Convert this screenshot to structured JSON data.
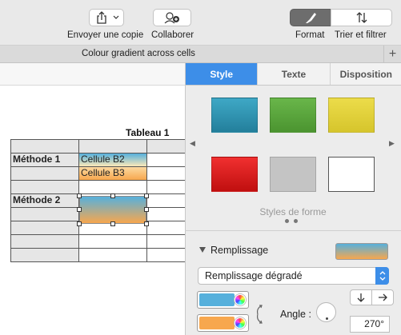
{
  "toolbar": {
    "share_label": "Envoyer une copie",
    "collab_label": "Collaborer",
    "format_label": "Format",
    "sort_label": "Trier et filtrer"
  },
  "document": {
    "tab_title": "Colour gradient across cells",
    "add_tab": "+"
  },
  "table": {
    "title": "Tableau 1",
    "rows": [
      {
        "c1": "",
        "c2": "",
        "c3": ""
      },
      {
        "c1": "Méthode 1",
        "c2": "Cellule B2",
        "c3": ""
      },
      {
        "c1": "",
        "c2": "Cellule B3",
        "c3": ""
      },
      {
        "c1": "Méthode 2",
        "c2": "",
        "c3": ""
      }
    ]
  },
  "inspector": {
    "tabs": [
      "Style",
      "Texte",
      "Disposition"
    ],
    "active_tab": "Style",
    "swatches": [
      {
        "name": "teal",
        "color": "#2f9ab8"
      },
      {
        "name": "green",
        "color": "#5aaa3c"
      },
      {
        "name": "yellow",
        "color": "#e3d43a"
      },
      {
        "name": "red",
        "color": "#e01b1b"
      },
      {
        "name": "gray",
        "color": "#c4c4c4"
      },
      {
        "name": "white",
        "color": "#ffffff"
      }
    ],
    "styles_label": "Styles de forme",
    "fill_title": "Remplissage",
    "fill_type": "Remplissage dégradé",
    "color_start": "#56b0dc",
    "color_end": "#f7a74e",
    "angle_label": "Angle :",
    "angle_value": "270°"
  }
}
